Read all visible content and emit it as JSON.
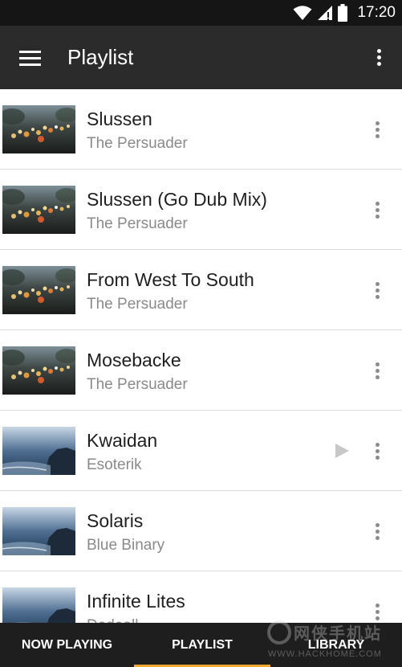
{
  "status_bar": {
    "time": "17:20",
    "icons": [
      "wifi-icon",
      "signal-icon",
      "battery-icon"
    ]
  },
  "app_bar": {
    "title": "Playlist",
    "menu_icon": "hamburger-menu-icon",
    "overflow_icon": "more-vert-icon"
  },
  "playlist": [
    {
      "title": "Slussen",
      "artist": "The Persuader",
      "artwork": "city-lights"
    },
    {
      "title": "Slussen (Go Dub Mix)",
      "artist": "The Persuader",
      "artwork": "city-lights"
    },
    {
      "title": "From West To South",
      "artist": "The Persuader",
      "artwork": "city-lights"
    },
    {
      "title": "Mosebacke",
      "artist": "The Persuader",
      "artwork": "city-lights"
    },
    {
      "title": "Kwaidan",
      "artist": "Esoterik",
      "artwork": "ocean-cliff",
      "now_playing": true
    },
    {
      "title": "Solaris",
      "artist": "Blue Binary",
      "artwork": "ocean-cliff"
    },
    {
      "title": "Infinite Lites",
      "artist": "Dedeall",
      "artwork": "ocean-cliff"
    }
  ],
  "bottom_nav": {
    "tabs": [
      "NOW PLAYING",
      "PLAYLIST",
      "LIBRARY"
    ],
    "active": "PLAYLIST",
    "accent": "#f0a830"
  },
  "watermark": {
    "text": "网侠手机站",
    "url": "WWW.HACKHOME.COM"
  },
  "colors": {
    "app_bar": "#2b2b2b",
    "status_bar": "#151515",
    "nav_bar": "#1e1e1e",
    "secondary_text": "#8a8a8a"
  }
}
